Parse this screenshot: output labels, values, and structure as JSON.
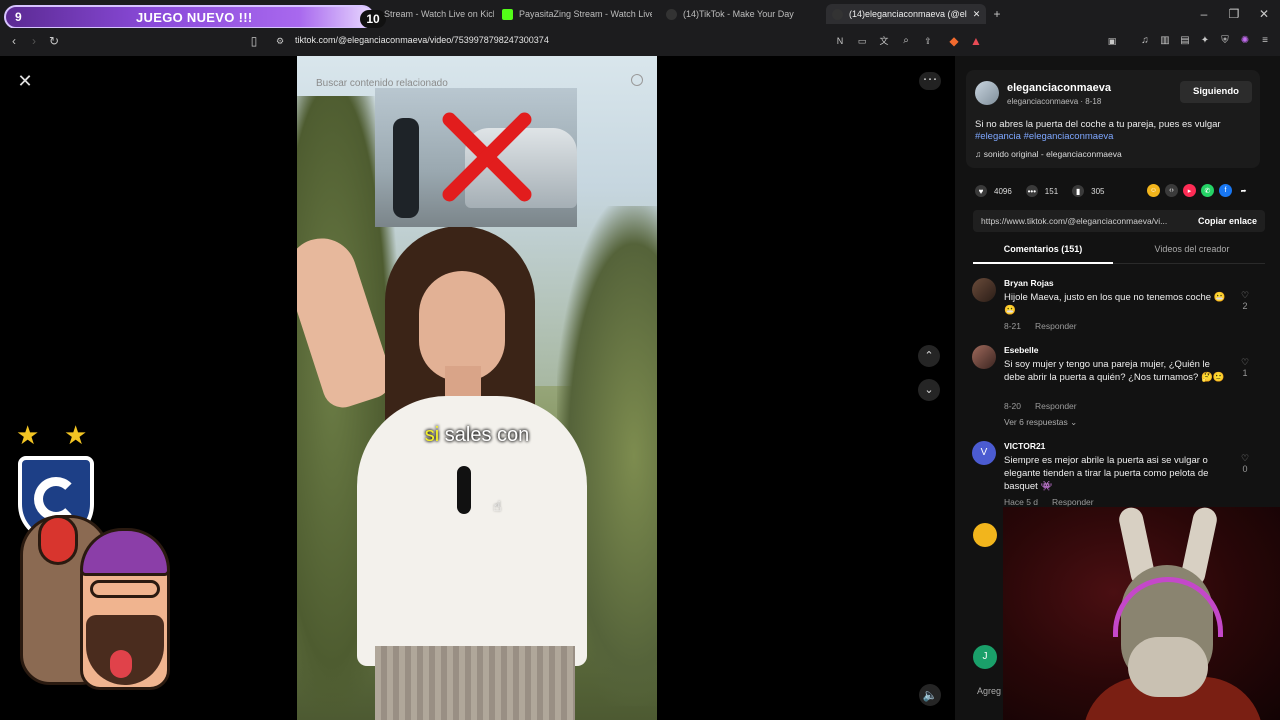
{
  "browser": {
    "banner": {
      "left_number": "9",
      "title": "JUEGO NUEVO !!!",
      "right_number": "10"
    },
    "tabs": [
      {
        "label": "Stream - Watch Live on Kick",
        "icon": "kick-icon",
        "color": "#53fc18"
      },
      {
        "label": "PayasitaZing Stream - Watch Live on",
        "icon": "kick-icon",
        "color": "#53fc18"
      },
      {
        "label": "(14)TikTok - Make Your Day",
        "icon": "tiktok-icon",
        "color": "#ffffff"
      },
      {
        "label": "(14)eleganciaconmaeva (@el",
        "icon": "tiktok-icon",
        "color": "#ffffff",
        "active": true
      }
    ],
    "url": "tiktok.com/@eleganciaconmaeva/video/7539978798247300374"
  },
  "video": {
    "search_placeholder": "Buscar contenido relacionado",
    "caption_highlight": "si",
    "caption_rest": "sales con"
  },
  "panel": {
    "author": "eleganciaconmaeva",
    "author_sub": "eleganciaconmaeva · 8-18",
    "follow_label": "Siguiendo",
    "description": "Si no abres la puerta del coche a tu pareja, pues es vulgar",
    "hashtags": "#elegancia #eleganciaconmaeva",
    "sound": "sonido original - eleganciaconmaeva",
    "likes": "4096",
    "comments_count": "151",
    "saves": "305",
    "link": "https://www.tiktok.com/@eleganciaconmaeva/vi...",
    "copy_label": "Copiar enlace",
    "tab_comments": "Comentarios (151)",
    "tab_creator": "Videos del creador",
    "add_comment": "Agreg"
  },
  "comments": [
    {
      "name": "Bryan Rojas",
      "text": "Hijole Maeva, justo en los que no tenemos coche 😬😬",
      "date": "8-21",
      "reply": "Responder",
      "likes": "2"
    },
    {
      "name": "Esebelle",
      "text": "Si soy mujer y tengo una pareja mujer, ¿Quién le debe abrir la puerta a quién? ¿Nos turnamos? 🤔🙂",
      "date": "8-20",
      "reply": "Responder",
      "likes": "1",
      "replies": "Ver 6 respuestas ⌄"
    },
    {
      "name": "VICTOR21",
      "text": "Siempre es mejor abrile la puerta asi se vulgar o elegante tienden a tirar la puerta como pelota de basquet 👾",
      "date": "Hace 5 d",
      "reply": "Responder",
      "likes": "0",
      "avatar_letter": "V"
    }
  ],
  "extra_avatar_letter": "J",
  "colors": {
    "accent_tag": "#7ea7ff",
    "banner_purple": "#8a4ad9",
    "panel_bg": "#121212"
  }
}
